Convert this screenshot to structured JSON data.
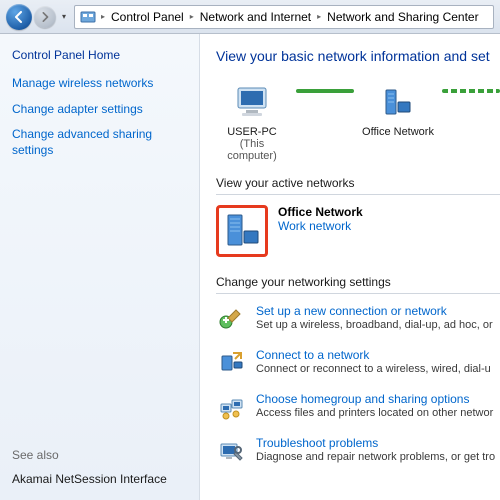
{
  "breadcrumb": {
    "items": [
      "Control Panel",
      "Network and Internet",
      "Network and Sharing Center"
    ]
  },
  "sidebar": {
    "home": "Control Panel Home",
    "links": [
      "Manage wireless networks",
      "Change adapter settings",
      "Change advanced sharing settings"
    ],
    "seealso_header": "See also",
    "seealso": [
      "Akamai NetSession Interface"
    ]
  },
  "main": {
    "title": "View your basic network information and set",
    "map": {
      "node1_label": "USER-PC",
      "node1_sub": "(This computer)",
      "node2_label": "Office Network"
    },
    "active_header": "View your active networks",
    "active_network": {
      "name": "Office Network",
      "type": "Work network"
    },
    "settings_header": "Change your networking settings",
    "settings": [
      {
        "title": "Set up a new connection or network",
        "desc": "Set up a wireless, broadband, dial-up, ad hoc, or"
      },
      {
        "title": "Connect to a network",
        "desc": "Connect or reconnect to a wireless, wired, dial-u"
      },
      {
        "title": "Choose homegroup and sharing options",
        "desc": "Access files and printers located on other networ"
      },
      {
        "title": "Troubleshoot problems",
        "desc": "Diagnose and repair network problems, or get tro"
      }
    ]
  }
}
